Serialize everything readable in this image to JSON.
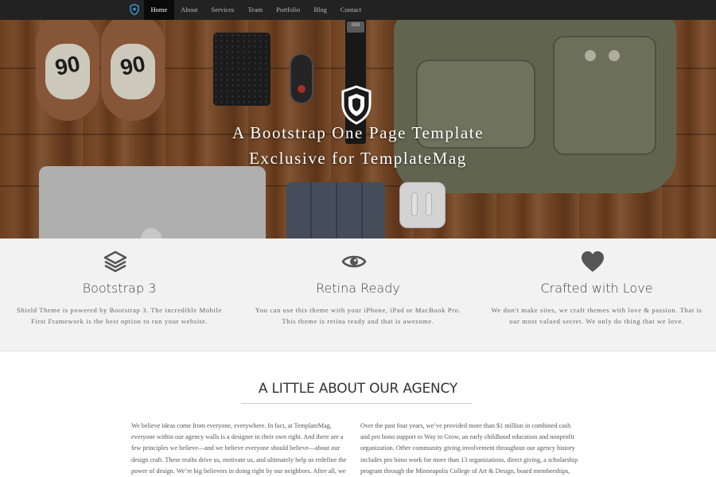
{
  "navbar": {
    "brand_icon": "shield-icon",
    "items": [
      {
        "label": "Home",
        "active": true
      },
      {
        "label": "About",
        "active": false
      },
      {
        "label": "Services",
        "active": false
      },
      {
        "label": "Team",
        "active": false
      },
      {
        "label": "Portfolio",
        "active": false
      },
      {
        "label": "Blog",
        "active": false
      },
      {
        "label": "Contact",
        "active": false
      }
    ]
  },
  "hero": {
    "title_line1": "A Bootstrap One Page Template",
    "title_line2": "Exclusive for TemplateMag",
    "logo_icon": "shield-icon",
    "shoe_number": "90",
    "watch_readout": "888"
  },
  "features": [
    {
      "icon": "layers-icon",
      "title": "Bootstrap 3",
      "text": "Shield Theme is powered by Bootstrap 3. The incredible Mobile First Framework is the best option to run your website."
    },
    {
      "icon": "eye-icon",
      "title": "Retina Ready",
      "text": "You can use this theme with your iPhone, iPad or MacBook Pro. This theme is retina ready and that is awesome."
    },
    {
      "icon": "heart-icon",
      "title": "Crafted with Love",
      "text": "We don't make sites, we craft themes with love & passion. That is our most valued secret. We only do thing that we love."
    }
  ],
  "about": {
    "heading": "A LITTLE ABOUT OUR AGENCY",
    "col1": "We believe ideas come from everyone, everywhere. In fact, at TemplateMag, everyone within our agency walls is a designer in their own right. And there are a few principles we believe—and we believe everyone should believe—about our design craft. These truths drive us, motivate us, and ultimately help us redefine the power of design. We’re big believers in doing right by our neighbors. After all, we",
    "col2": "Over the past four years, we’ve provided more than $1 million in combined cash and pro bono support to Way to Grow, an early childhood education and nonprofit organization. Other community giving involvement throughout our agency history includes pro bono work for more than 13 organizations, direct giving, a scholarship program through the Minneapolis College of Art & Design, board memberships, and"
  },
  "colors": {
    "nav_bg": "#222222",
    "nav_active_bg": "#0a0a0a",
    "brand_accent": "#3a9ad9",
    "features_bg": "#f2f2f2",
    "icon_color": "#555555"
  }
}
